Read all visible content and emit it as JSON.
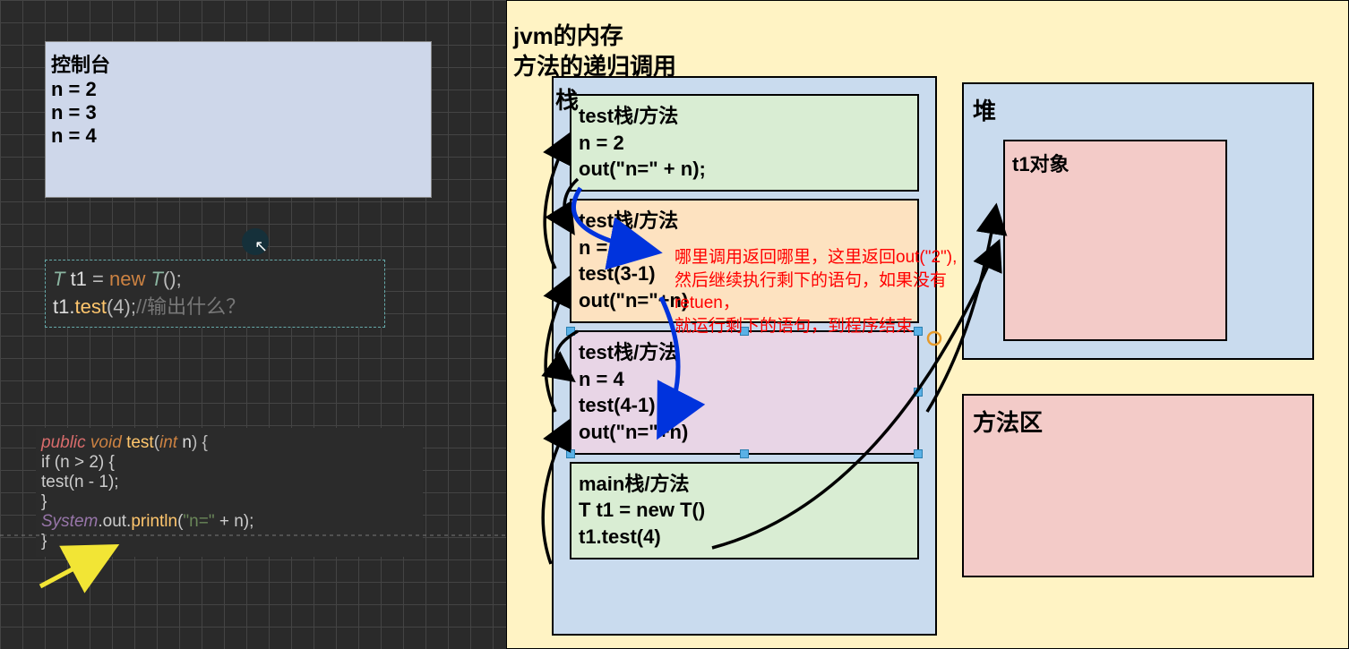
{
  "titles": {
    "jvm1": "jvm的内存",
    "jvm2": "方法的递归调用",
    "stack": "栈",
    "heap": "堆",
    "methodArea": "方法区"
  },
  "console": {
    "title": "控制台",
    "l1": "n = 2",
    "l2": "n = 3",
    "l3": "n = 4"
  },
  "code1": {
    "l1_type": "T",
    "l1_var": " t1 ",
    "l1_eq": "= ",
    "l1_new": "new ",
    "l1_T": "T",
    "l1_paren": "();",
    "l2_a": "t1.",
    "l2_fn": "test",
    "l2_b": "(4);",
    "l2_c": "//输出什么？"
  },
  "code2": {
    "l1_a": "public ",
    "l1_b": " void ",
    "l1_c": "test",
    "l1_d": "(",
    "l1_e": "int ",
    "l1_f": "n",
    "l1_g": ") {",
    "l2": "    if (n > 2) {",
    "l3": "        test(n - 1);",
    "l4": "    }",
    "l5_a": "    ",
    "l5_sys": "System",
    "l5_b": ".out.",
    "l5_c": "println",
    "l5_d": "(",
    "l5_str": "\"n=\"",
    "l5_e": " + n);",
    "l6": "}"
  },
  "frames": {
    "f2": {
      "t": "test栈/方法",
      "n": "n = 2",
      "c": "out(\"n=\" + n);"
    },
    "f3": {
      "t": "test栈/方法",
      "n": "n = 3",
      "c": "test(3-1)",
      "o": "out(\"n=\"+n)"
    },
    "f4": {
      "t": "test栈/方法",
      "n": "n = 4",
      "c": "test(4-1)",
      "o": "out(\"n=\"+n)"
    },
    "main": {
      "t": "main栈/方法",
      "a": "T t1 = new T()",
      "b": "t1.test(4)"
    }
  },
  "heap": {
    "obj": "t1对象"
  },
  "redNote": {
    "l1": "哪里调用返回哪里，这里返回out(\"2\"),",
    "l2": "然后继续执行剩下的语句，如果没有retuen，",
    "l3": "就运行剩下的语句，到程序结束"
  }
}
